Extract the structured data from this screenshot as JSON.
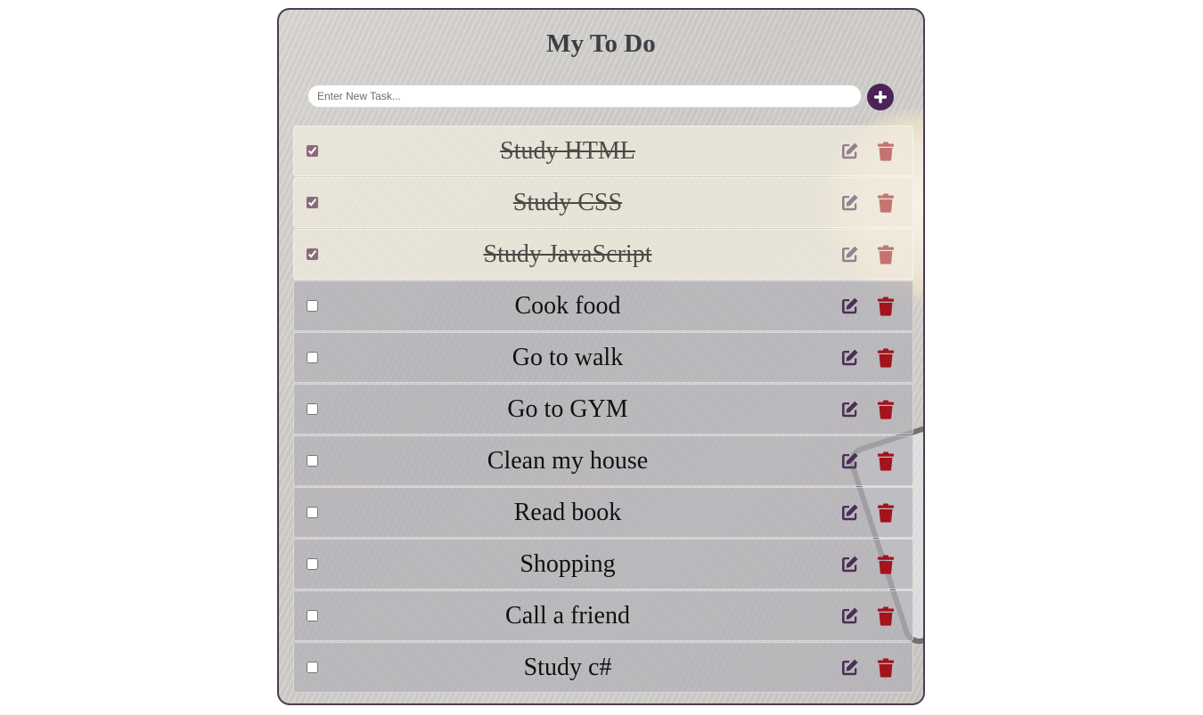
{
  "app": {
    "title": "My To Do",
    "accent_color": "#4a2456",
    "delete_color": "#a3141c"
  },
  "new_task": {
    "placeholder": "Enter New Task...",
    "value": "",
    "add_icon": "plus-circle-icon"
  },
  "tasks": [
    {
      "label": "Study HTML",
      "done": true
    },
    {
      "label": "Study CSS",
      "done": true
    },
    {
      "label": "Study JavaScript",
      "done": true
    },
    {
      "label": "Cook food",
      "done": false
    },
    {
      "label": "Go to walk",
      "done": false
    },
    {
      "label": "Go to GYM",
      "done": false
    },
    {
      "label": "Clean my house",
      "done": false
    },
    {
      "label": "Read book",
      "done": false
    },
    {
      "label": "Shopping",
      "done": false
    },
    {
      "label": "Call a friend",
      "done": false
    },
    {
      "label": "Study c#",
      "done": false
    }
  ],
  "icons": {
    "edit": "edit-icon",
    "delete": "trash-icon"
  }
}
